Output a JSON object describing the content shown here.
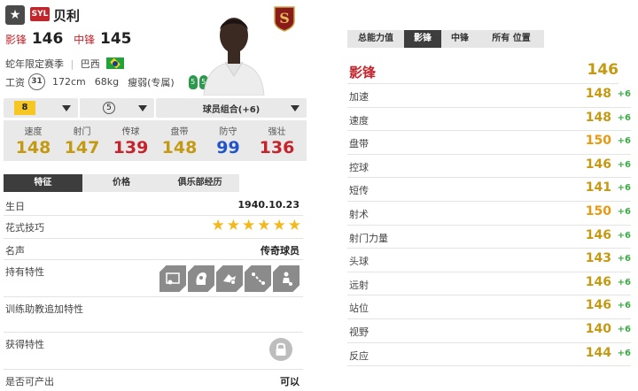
{
  "colors": {
    "red": "#c4242b",
    "gold": "#c49a12",
    "orange": "#e79a10",
    "green": "#3aaa45",
    "blue": "#2354c8",
    "yellow": "#f6c623"
  },
  "player": {
    "season_badge": "SYL",
    "name": "贝利",
    "positions": [
      {
        "pos": "影锋",
        "ovr": "146"
      },
      {
        "pos": "中锋",
        "ovr": "145"
      }
    ],
    "season": "蛇年限定赛季",
    "nation": "巴西",
    "nation_flag_icon": "brazil-flag-icon",
    "salary_label": "工资",
    "salary": "31",
    "height": "172cm",
    "weight": "68kg",
    "body_type": "瘦弱(专属)",
    "left_foot": "5",
    "right_foot": "5"
  },
  "dropdowns": {
    "enhance_level": "8",
    "advance_level": "5",
    "combo_label": "球员组合(+6)"
  },
  "summary": [
    {
      "label": "速度",
      "value": "148",
      "color": "#c49a12"
    },
    {
      "label": "射门",
      "value": "147",
      "color": "#c49a12"
    },
    {
      "label": "传球",
      "value": "139",
      "color": "#c4242b"
    },
    {
      "label": "盘带",
      "value": "148",
      "color": "#c49a12"
    },
    {
      "label": "防守",
      "value": "99",
      "color": "#2354c8"
    },
    {
      "label": "强壮",
      "value": "136",
      "color": "#c4242b"
    }
  ],
  "tabs": [
    "特征",
    "价格",
    "俱乐部经历"
  ],
  "info": {
    "birthday_label": "生日",
    "birthday": "1940.10.23",
    "skill_label": "花式技巧",
    "skill_stars": 6,
    "reputation_label": "名声",
    "reputation": "传奇球员",
    "traits_label": "持有特性",
    "traits_icons": [
      "trait-icon-1",
      "trait-icon-2",
      "trait-icon-3",
      "trait-icon-4",
      "trait-icon-5"
    ],
    "coach_traits_label": "训练助教追加特性",
    "gained_traits_label": "获得特性",
    "gained_traits_icon": "lock-icon",
    "produce_label": "是否可产出",
    "produce": "可以"
  },
  "right_tabs": [
    "总能力值",
    "影锋",
    "中锋",
    "所有 位置"
  ],
  "position_header": {
    "label": "影锋",
    "value": "146"
  },
  "attributes": [
    {
      "label": "加速",
      "value": "148",
      "bonus": "+6",
      "color": "#c49a12"
    },
    {
      "label": "速度",
      "value": "148",
      "bonus": "+6",
      "color": "#c49a12"
    },
    {
      "label": "盘带",
      "value": "150",
      "bonus": "+6",
      "color": "#e79a10"
    },
    {
      "label": "控球",
      "value": "146",
      "bonus": "+6",
      "color": "#c49a12"
    },
    {
      "label": "短传",
      "value": "141",
      "bonus": "+6",
      "color": "#c49a12"
    },
    {
      "label": "射术",
      "value": "150",
      "bonus": "+6",
      "color": "#e79a10"
    },
    {
      "label": "射门力量",
      "value": "146",
      "bonus": "+6",
      "color": "#c49a12"
    },
    {
      "label": "头球",
      "value": "143",
      "bonus": "+6",
      "color": "#c49a12"
    },
    {
      "label": "远射",
      "value": "146",
      "bonus": "+6",
      "color": "#c49a12"
    },
    {
      "label": "站位",
      "value": "146",
      "bonus": "+6",
      "color": "#c49a12"
    },
    {
      "label": "视野",
      "value": "140",
      "bonus": "+6",
      "color": "#c49a12"
    },
    {
      "label": "反应",
      "value": "144",
      "bonus": "+6",
      "color": "#c49a12"
    }
  ]
}
